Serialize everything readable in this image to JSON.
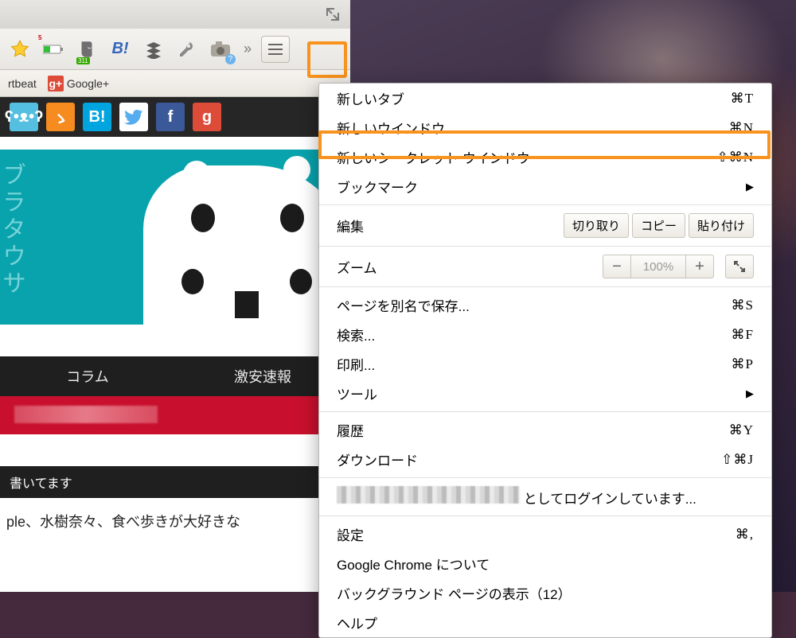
{
  "toolbar": {
    "badge5": "5",
    "badge311": "311",
    "hatena_label": "B!",
    "overflow": "»"
  },
  "bookmarks": {
    "artbeat": "rtbeat",
    "gplus": "Google+"
  },
  "share_icons": {
    "rss": "ゝ",
    "hatena": "B!",
    "twitter": "t",
    "facebook": "f",
    "google": "g"
  },
  "hero": {
    "kana": "ブラタウサ"
  },
  "tabs": {
    "column": "コラム",
    "news": "激安速報"
  },
  "writes": {
    "head": "書いてます",
    "body": "ple、水樹奈々、食べ歩きが大好きな"
  },
  "menu": {
    "new_tab": {
      "label": "新しいタブ",
      "sc": "⌘T"
    },
    "new_window": {
      "label": "新しいウインドウ",
      "sc": "⌘N"
    },
    "incognito": {
      "label": "新しいシークレット ウインドウ",
      "sc": "⇧⌘N"
    },
    "bookmarks": {
      "label": "ブックマーク"
    },
    "edit": {
      "label": "編集",
      "cut": "切り取り",
      "copy": "コピー",
      "paste": "貼り付け"
    },
    "zoom": {
      "label": "ズーム",
      "value": "100%"
    },
    "save_as": {
      "label": "ページを別名で保存...",
      "sc": "⌘S"
    },
    "find": {
      "label": "検索...",
      "sc": "⌘F"
    },
    "print": {
      "label": "印刷...",
      "sc": "⌘P"
    },
    "tools": {
      "label": "ツール"
    },
    "history": {
      "label": "履歴",
      "sc": "⌘Y"
    },
    "downloads": {
      "label": "ダウンロード",
      "sc": "⇧⌘J"
    },
    "login_suffix": " としてログインしています...",
    "settings": {
      "label": "設定",
      "sc": "⌘,"
    },
    "about": {
      "label": "Google Chrome について"
    },
    "background": {
      "label": "バックグラウンド ページの表示（12）"
    },
    "help": {
      "label": "ヘルプ"
    }
  }
}
